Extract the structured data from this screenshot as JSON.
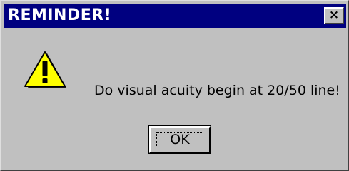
{
  "dialog": {
    "title": "REMINDER!",
    "close_label": "×",
    "message": "Do visual acuity begin at 20/50 line!",
    "ok_label": "OK",
    "icon": "warning-icon"
  },
  "colors": {
    "titlebar": "#000080",
    "face": "#c0c0c0",
    "warning_fill": "#ffff00"
  }
}
